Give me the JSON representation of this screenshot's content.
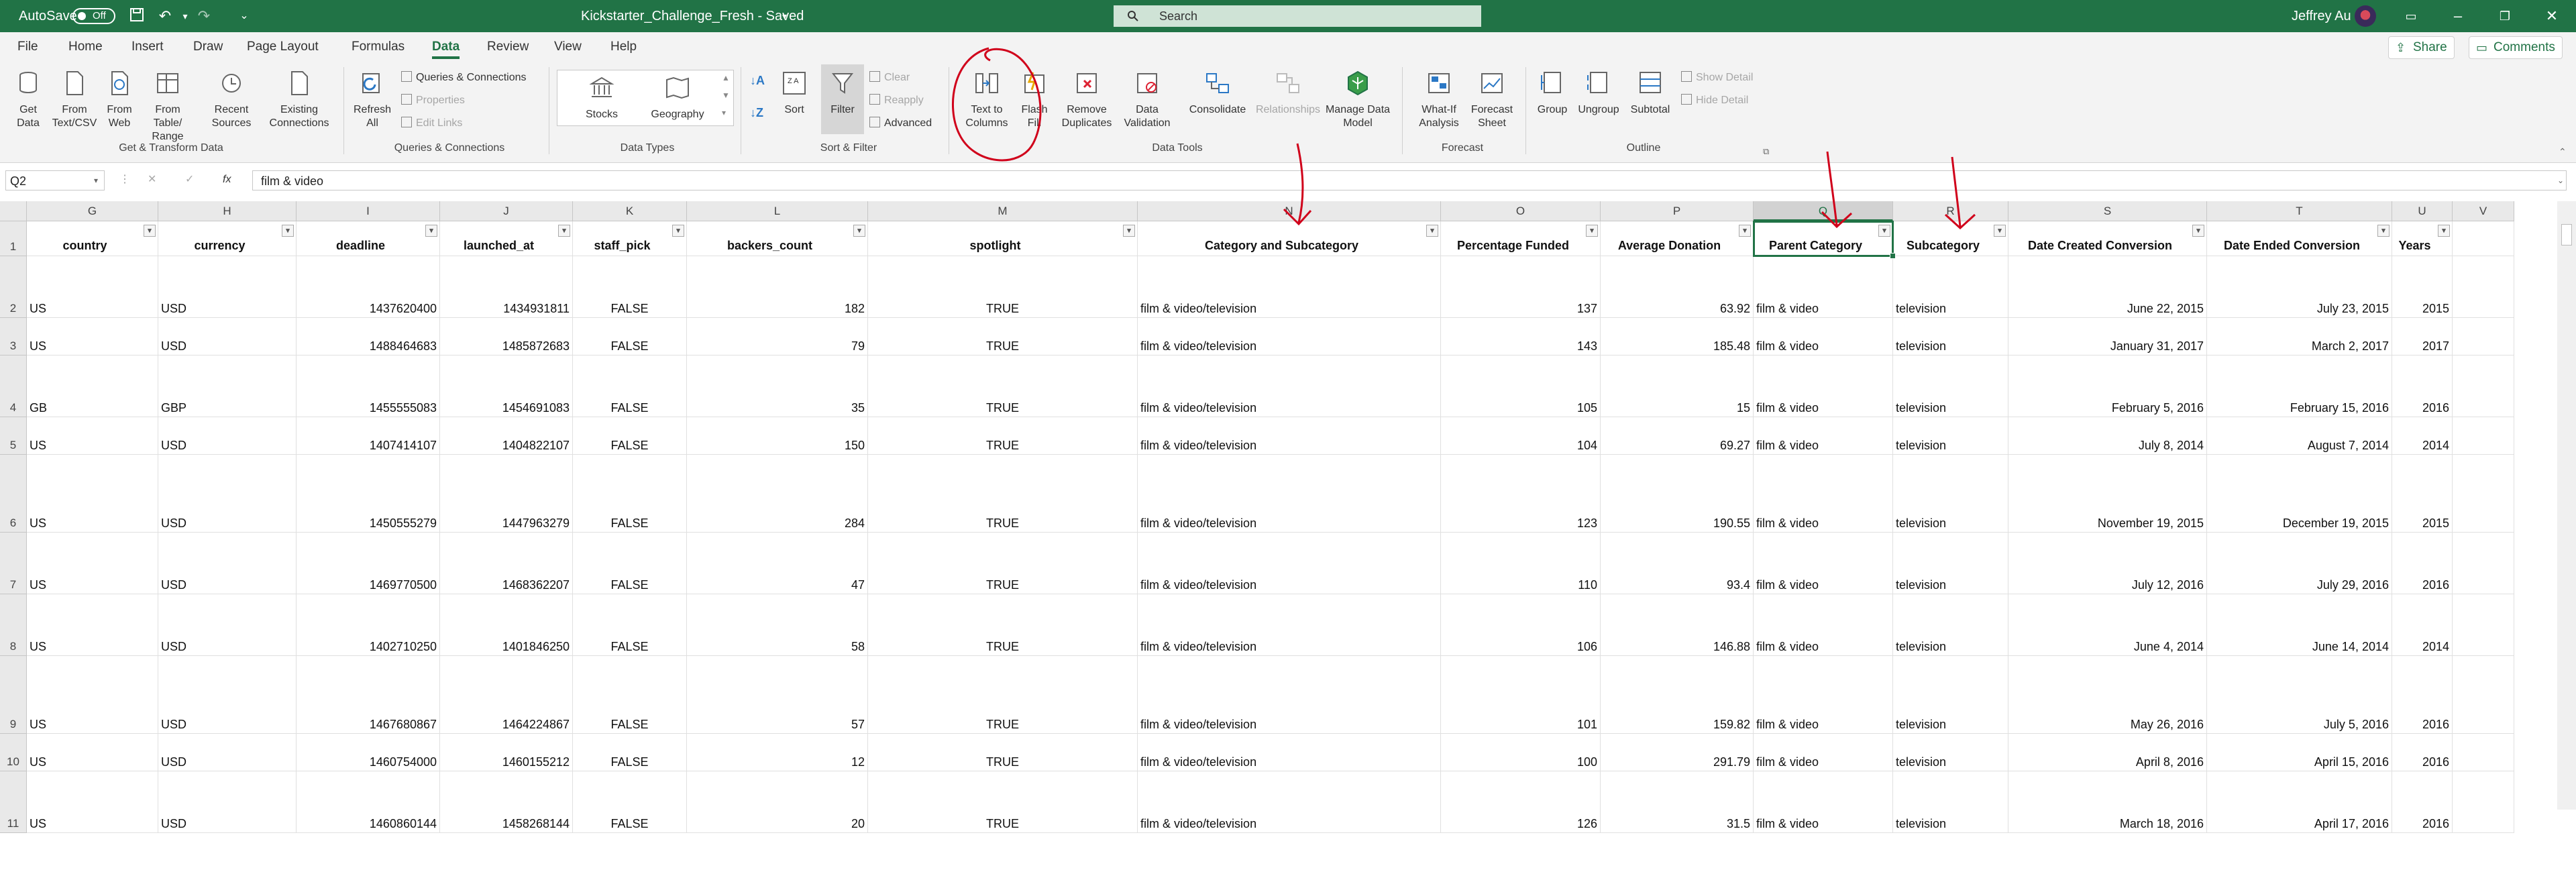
{
  "titlebar": {
    "autosave_label": "AutoSave",
    "autosave_state": "Off",
    "doc_title": "Kickstarter_Challenge_Fresh  -  Saved",
    "search_placeholder": "Search",
    "user_name": "Jeffrey Au",
    "bg_color": "#217346"
  },
  "tabs": [
    {
      "label": "File"
    },
    {
      "label": "Home"
    },
    {
      "label": "Insert"
    },
    {
      "label": "Draw"
    },
    {
      "label": "Page Layout"
    },
    {
      "label": "Formulas"
    },
    {
      "label": "Data",
      "active": true
    },
    {
      "label": "Review"
    },
    {
      "label": "View"
    },
    {
      "label": "Help"
    }
  ],
  "share_label": "Share",
  "comments_label": "Comments",
  "ribbon": {
    "get_data": "Get Data",
    "from_text_csv": "From Text/CSV",
    "from_web": "From Web",
    "from_table_range": "From Table/ Range",
    "recent_sources": "Recent Sources",
    "existing_connections": "Existing Connections",
    "group_get_transform": "Get & Transform Data",
    "refresh_all": "Refresh All",
    "queries_connections": "Queries & Connections",
    "properties": "Properties",
    "edit_links": "Edit Links",
    "group_queries": "Queries & Connections",
    "stocks": "Stocks",
    "geography": "Geography",
    "group_data_types": "Data Types",
    "sort": "Sort",
    "filter": "Filter",
    "clear": "Clear",
    "reapply": "Reapply",
    "advanced": "Advanced",
    "group_sort_filter": "Sort & Filter",
    "text_to_columns": "Text to Columns",
    "flash_fill": "Flash Fill",
    "remove_duplicates": "Remove Duplicates",
    "data_validation": "Data Validation",
    "consolidate": "Consolidate",
    "relationships": "Relationships",
    "manage_data_model": "Manage Data Model",
    "group_data_tools": "Data Tools",
    "what_if": "What-If Analysis",
    "forecast_sheet": "Forecast Sheet",
    "group_forecast": "Forecast",
    "group": "Group",
    "ungroup": "Ungroup",
    "subtotal": "Subtotal",
    "show_detail": "Show Detail",
    "hide_detail": "Hide Detail",
    "group_outline": "Outline"
  },
  "formula_bar": {
    "name_box": "Q2",
    "fx": "fx",
    "value": "film & video"
  },
  "grid": {
    "columns": [
      "G",
      "H",
      "I",
      "J",
      "K",
      "L",
      "M",
      "N",
      "O",
      "P",
      "Q",
      "R",
      "S",
      "T",
      "U",
      "V"
    ],
    "selected_column": "Q",
    "header_row": [
      "country",
      "currency",
      "deadline",
      "launched_at",
      "staff_pick",
      "backers_count",
      "spotlight",
      "Category and Subcategory",
      "Percentage Funded",
      "Average Donation",
      "Parent Category",
      "Subcategory",
      "Date Created Conversion",
      "Date Ended Conversion",
      "Years",
      ""
    ],
    "row_numbers": [
      "1",
      "2",
      "3",
      "4",
      "5",
      "6",
      "7",
      "8",
      "9",
      "10",
      "11"
    ],
    "rows": [
      [
        "US",
        "USD",
        "1437620400",
        "1434931811",
        "FALSE",
        "182",
        "TRUE",
        "film & video/television",
        "137",
        "63.92",
        "film & video",
        "television",
        "June 22, 2015",
        "July 23, 2015",
        "2015",
        ""
      ],
      [
        "US",
        "USD",
        "1488464683",
        "1485872683",
        "FALSE",
        "79",
        "TRUE",
        "film & video/television",
        "143",
        "185.48",
        "film & video",
        "television",
        "January 31, 2017",
        "March 2, 2017",
        "2017",
        ""
      ],
      [
        "GB",
        "GBP",
        "1455555083",
        "1454691083",
        "FALSE",
        "35",
        "TRUE",
        "film & video/television",
        "105",
        "15",
        "film & video",
        "television",
        "February 5, 2016",
        "February 15, 2016",
        "2016",
        ""
      ],
      [
        "US",
        "USD",
        "1407414107",
        "1404822107",
        "FALSE",
        "150",
        "TRUE",
        "film & video/television",
        "104",
        "69.27",
        "film & video",
        "television",
        "July 8, 2014",
        "August 7, 2014",
        "2014",
        ""
      ],
      [
        "US",
        "USD",
        "1450555279",
        "1447963279",
        "FALSE",
        "284",
        "TRUE",
        "film & video/television",
        "123",
        "190.55",
        "film & video",
        "television",
        "November 19, 2015",
        "December 19, 2015",
        "2015",
        ""
      ],
      [
        "US",
        "USD",
        "1469770500",
        "1468362207",
        "FALSE",
        "47",
        "TRUE",
        "film & video/television",
        "110",
        "93.4",
        "film & video",
        "television",
        "July 12, 2016",
        "July 29, 2016",
        "2016",
        ""
      ],
      [
        "US",
        "USD",
        "1402710250",
        "1401846250",
        "FALSE",
        "58",
        "TRUE",
        "film & video/television",
        "106",
        "146.88",
        "film & video",
        "television",
        "June 4, 2014",
        "June 14, 2014",
        "2014",
        ""
      ],
      [
        "US",
        "USD",
        "1467680867",
        "1464224867",
        "FALSE",
        "57",
        "TRUE",
        "film & video/television",
        "101",
        "159.82",
        "film & video",
        "television",
        "May 26, 2016",
        "July 5, 2016",
        "2016",
        ""
      ],
      [
        "US",
        "USD",
        "1460754000",
        "1460155212",
        "FALSE",
        "12",
        "TRUE",
        "film & video/television",
        "100",
        "291.79",
        "film & video",
        "television",
        "April 8, 2016",
        "April 15, 2016",
        "2016",
        ""
      ],
      [
        "US",
        "USD",
        "1460860144",
        "1458268144",
        "FALSE",
        "20",
        "TRUE",
        "film & video/television",
        "126",
        "31.5",
        "film & video",
        "television",
        "March 18, 2016",
        "April 17, 2016",
        "2016",
        ""
      ]
    ]
  }
}
